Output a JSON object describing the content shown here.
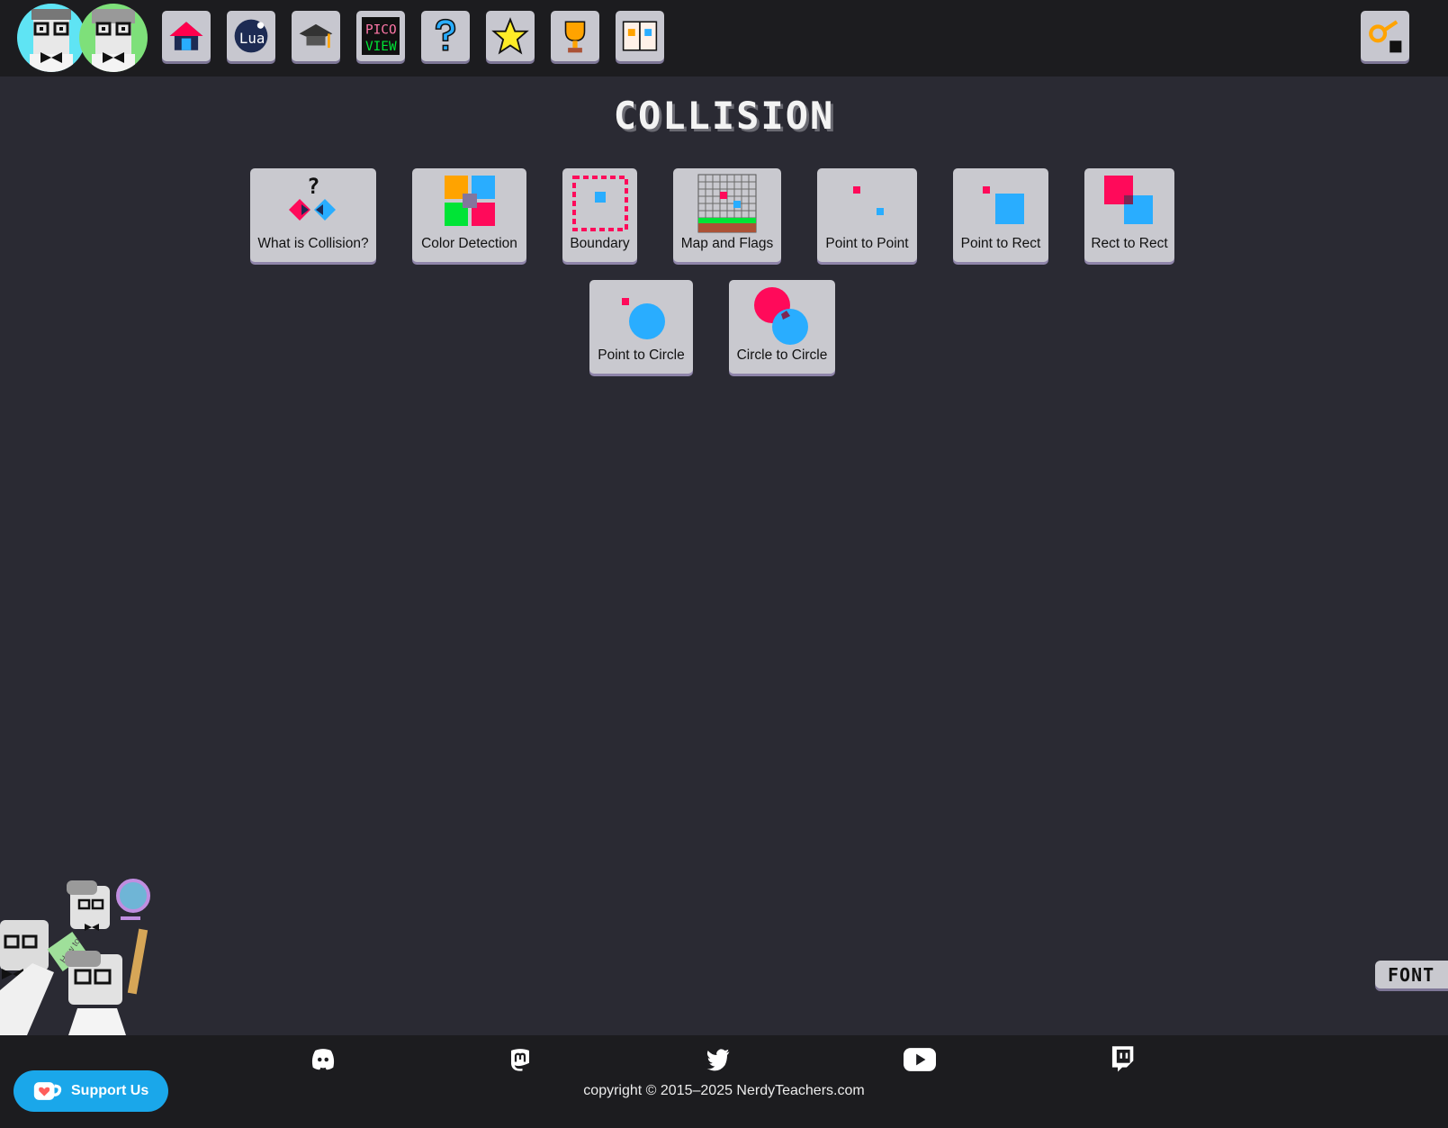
{
  "header": {
    "nav": [
      {
        "name": "home",
        "icon": "house-icon"
      },
      {
        "name": "lua",
        "icon": "lua-moon-icon"
      },
      {
        "name": "tutorials",
        "icon": "graduation-cap-icon"
      },
      {
        "name": "pico-view",
        "icon": "pico-view-icon"
      },
      {
        "name": "help",
        "icon": "question-mark-icon"
      },
      {
        "name": "favorites",
        "icon": "star-icon"
      },
      {
        "name": "achievements",
        "icon": "trophy-icon"
      },
      {
        "name": "guides",
        "icon": "book-icon"
      }
    ],
    "login_icon": "key-lock-icon"
  },
  "main": {
    "title": "COLLISION",
    "cards": [
      {
        "label": "What is Collision?"
      },
      {
        "label": "Color Detection"
      },
      {
        "label": "Boundary"
      },
      {
        "label": "Map and Flags"
      },
      {
        "label": "Point to Point"
      },
      {
        "label": "Point to Rect"
      },
      {
        "label": "Rect to Rect"
      },
      {
        "label": "Point to Circle"
      },
      {
        "label": "Circle to Circle"
      }
    ]
  },
  "font_toggle": "FONT",
  "footer": {
    "social": [
      "discord-icon",
      "mastodon-icon",
      "twitter-icon",
      "youtube-icon",
      "twitch-icon"
    ],
    "support_label": "Support Us",
    "copyright": "copyright © 2015–2025 NerdyTeachers.com"
  },
  "colors": {
    "red": "#ff0a5a",
    "blue": "#29adff",
    "background": "#2a2a33",
    "bar": "#1c1c1f"
  }
}
